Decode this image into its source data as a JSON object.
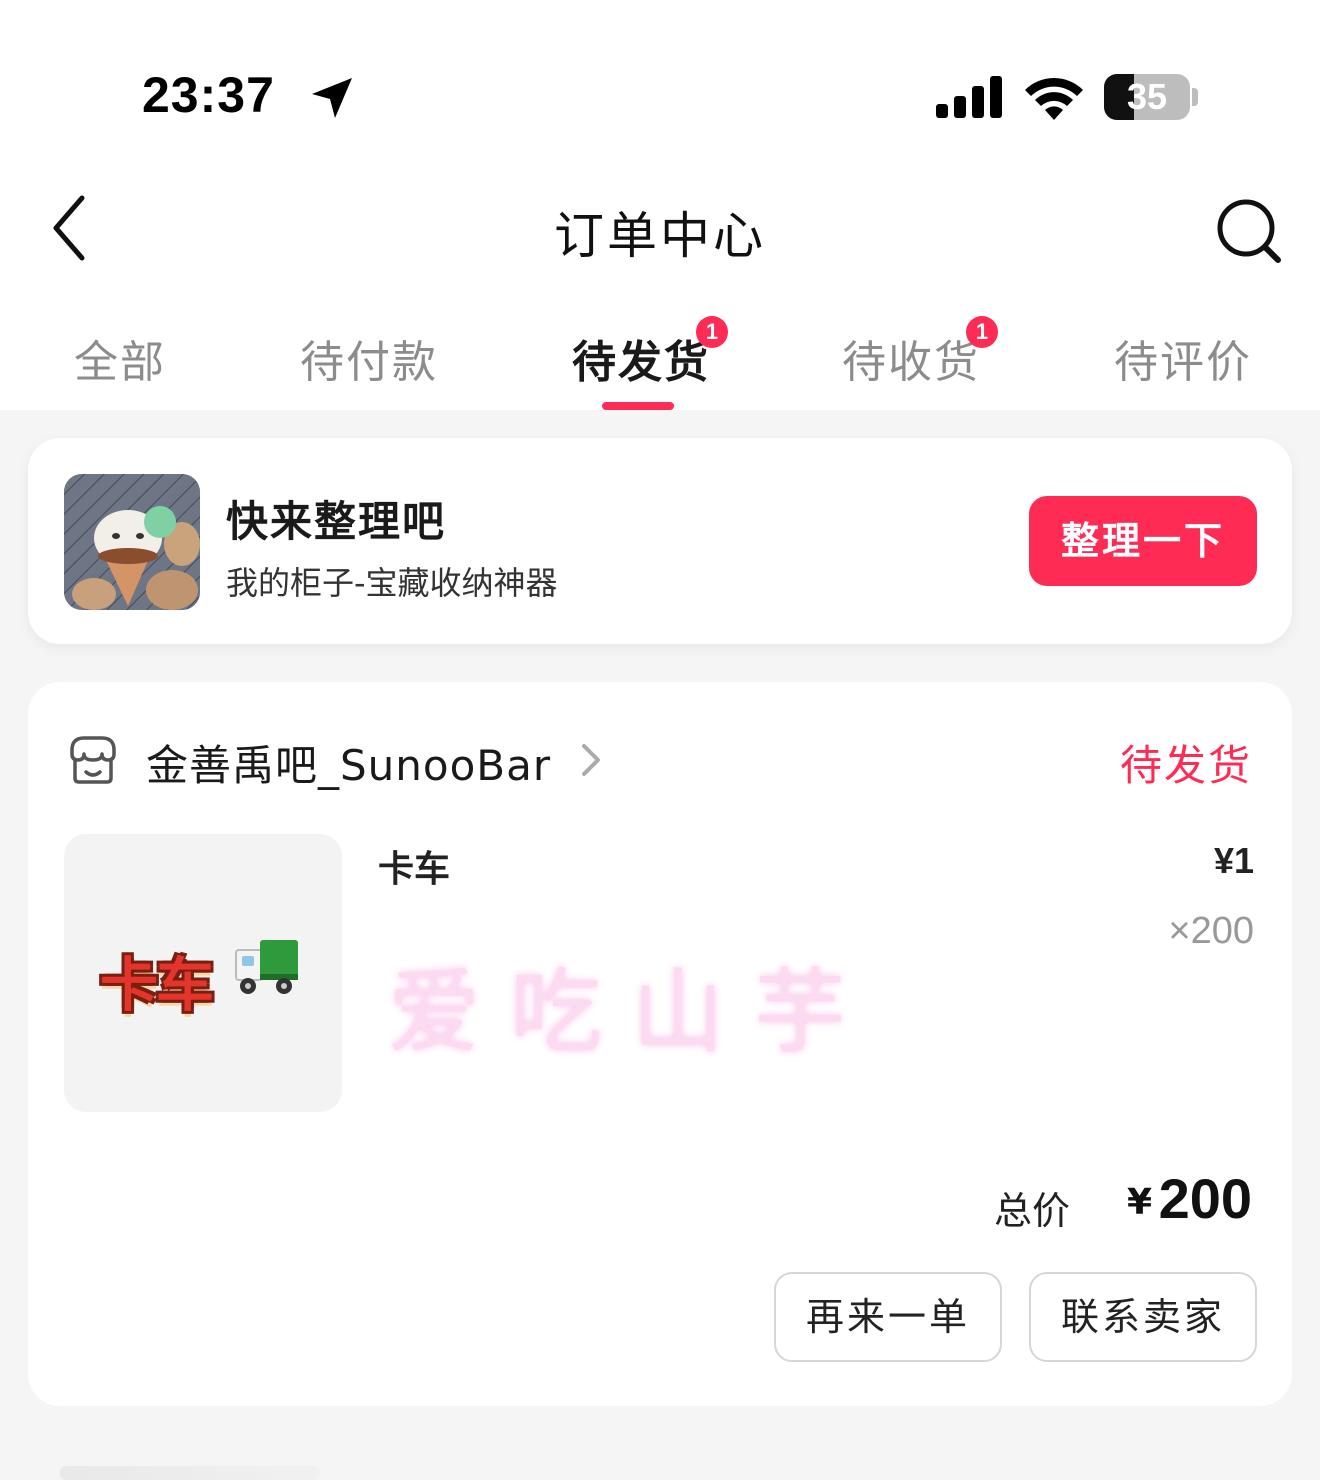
{
  "status_bar": {
    "time": "23:37",
    "battery": "35",
    "battery_level": 0.35,
    "icons": [
      "location-arrow-icon",
      "cellular-signal-icon",
      "wifi-icon",
      "battery-icon"
    ]
  },
  "nav": {
    "title": "订单中心",
    "icons": [
      "back-chevron-icon",
      "search-icon"
    ]
  },
  "tabs": [
    {
      "label": "全部",
      "badge": null,
      "active": false
    },
    {
      "label": "待付款",
      "badge": null,
      "active": false
    },
    {
      "label": "待发货",
      "badge": "1",
      "active": true
    },
    {
      "label": "待收货",
      "badge": "1",
      "active": false
    },
    {
      "label": "待评价",
      "badge": null,
      "active": false
    }
  ],
  "promo": {
    "title": "快来整理吧",
    "subtitle": "我的柜子-宝藏收纳神器",
    "button": "整理一下"
  },
  "order": {
    "shop_name": "金善禹吧_SunooBar",
    "status": "待发货",
    "product": {
      "sticker_text": "卡车",
      "name": "卡车",
      "price": "¥1",
      "quantity": "×200",
      "watermark": "爱吃山芋"
    },
    "total_label": "总价",
    "total_currency": "¥",
    "total_amount": "200",
    "buttons": {
      "reorder": "再来一单",
      "contact": "联系卖家"
    }
  },
  "colors": {
    "accent": "#fe2c55",
    "background": "#f5f5f5",
    "card": "#ffffff",
    "muted_text": "#8c8c8c"
  }
}
